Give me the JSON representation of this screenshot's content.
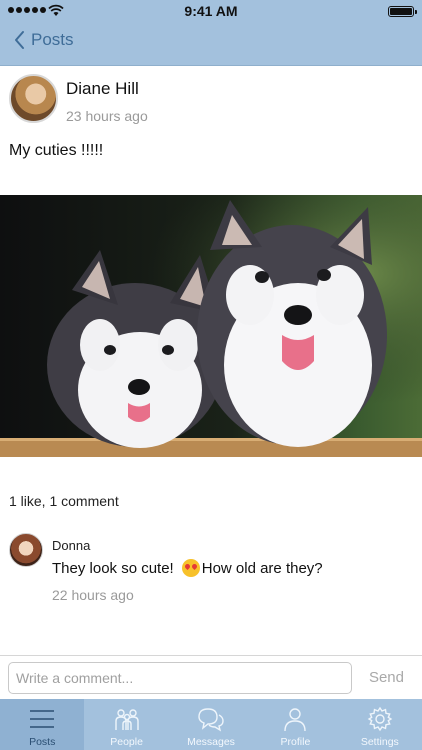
{
  "status_bar": {
    "time": "9:41 AM"
  },
  "nav": {
    "back_label": "Posts"
  },
  "post": {
    "author": "Diane Hill",
    "time": "23 hours ago",
    "text": "My cuties !!!!!",
    "stats": "1 like, 1 comment"
  },
  "comment": {
    "author": "Donna",
    "text_before_emoji": "They look so cute!",
    "text_after_emoji": "How old are they?",
    "time": "22 hours ago"
  },
  "composer": {
    "placeholder": "Write a comment...",
    "send_label": "Send"
  },
  "tabs": [
    {
      "label": "Posts",
      "icon": "list-icon"
    },
    {
      "label": "People",
      "icon": "people-icon"
    },
    {
      "label": "Messages",
      "icon": "chat-bubbles-icon"
    },
    {
      "label": "Profile",
      "icon": "person-icon"
    },
    {
      "label": "Settings",
      "icon": "gear-icon"
    }
  ],
  "colors": {
    "bar_background": "#a3c1dd",
    "active_tab": "#8fb1d2",
    "accent_text": "#3f6d98"
  }
}
